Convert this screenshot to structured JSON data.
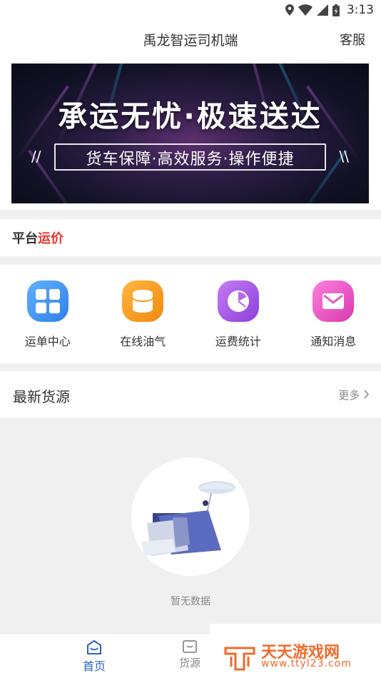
{
  "statusbar": {
    "time": "3:13"
  },
  "header": {
    "title": "禹龙智运司机端",
    "service_label": "客服"
  },
  "banner": {
    "headline": "承运无忧·极速送达",
    "subline": "货车保障·高效服务·操作便捷",
    "deco_left": "//",
    "deco_right": "\\\\"
  },
  "price_section": {
    "title_part1": "平台",
    "title_part2": "运价",
    "accent_color": "#e8342b"
  },
  "quick_menu": [
    {
      "label": "运单中心",
      "icon": "grid-icon",
      "color": "#3c8ff0"
    },
    {
      "label": "在线油气",
      "icon": "oil-drum-icon",
      "color": "#f0921f"
    },
    {
      "label": "运费统计",
      "icon": "pie-chart-icon",
      "color": "#a24fe0"
    },
    {
      "label": "通知消息",
      "icon": "envelope-icon",
      "color": "#e54fc3"
    }
  ],
  "latest": {
    "title": "最新货源",
    "more_label": "更多"
  },
  "empty": {
    "text": "暂无数据"
  },
  "tabs": [
    {
      "label": "首页",
      "icon": "home-icon",
      "active": true
    },
    {
      "label": "货源",
      "icon": "cargo-icon",
      "active": false
    }
  ],
  "watermark": {
    "title": "天天游戏网",
    "url": "www.ttyl23.com"
  }
}
